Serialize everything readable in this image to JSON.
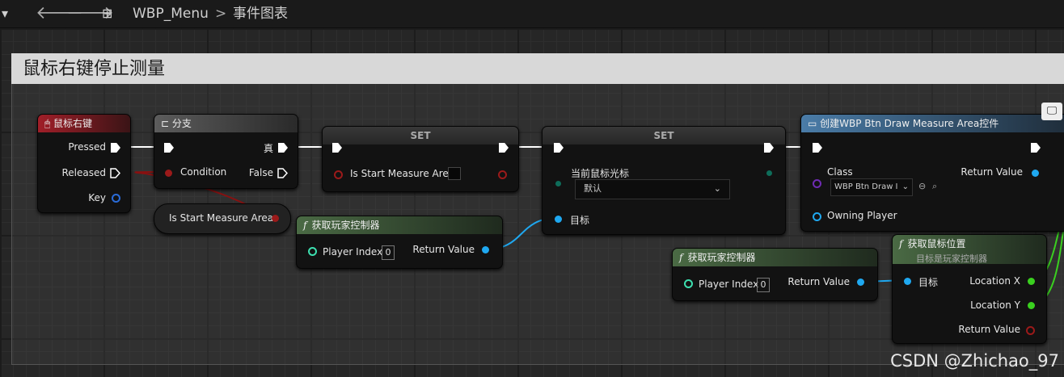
{
  "toolbar": {
    "left_icon": "menu-icon",
    "back": "back-arrow-icon",
    "forward": "forward-arrow-icon",
    "breadcrumb_root": "WBP_Menu",
    "breadcrumb_sep": ">",
    "breadcrumb_current": "事件图表"
  },
  "comment": {
    "title": "鼠标右键停止测量"
  },
  "nodes": {
    "right_mouse": {
      "title": "鼠标右键",
      "pressed": "Pressed",
      "released": "Released",
      "key": "Key"
    },
    "branch": {
      "title": "分支",
      "condition": "Condition",
      "true": "真",
      "false": "False"
    },
    "set1": {
      "title": "SET",
      "var": "Is Start Measure Area"
    },
    "getter": {
      "label": "Is Start Measure Area"
    },
    "get_pc1": {
      "title": "获取玩家控制器",
      "player_index": "Player Index",
      "index_value": "0",
      "return": "Return Value"
    },
    "set2": {
      "title": "SET",
      "cursor_label": "当前鼠标光标",
      "cursor_value": "默认",
      "target": "目标"
    },
    "create_widget": {
      "title": "创建WBP Btn Draw Measure Area控件",
      "class": "Class",
      "class_value": "WBP Btn Draw I",
      "owning_player": "Owning Player",
      "return": "Return Value"
    },
    "get_pc2": {
      "title": "获取玩家控制器",
      "player_index": "Player Index",
      "index_value": "0",
      "return": "Return Value"
    },
    "get_mouse_pos": {
      "title": "获取鼠标位置",
      "subtitle": "目标是玩家控制器",
      "target": "目标",
      "loc_x": "Location X",
      "loc_y": "Location Y",
      "return": "Return Value"
    }
  },
  "watermark": "CSDN @Zhichao_97"
}
